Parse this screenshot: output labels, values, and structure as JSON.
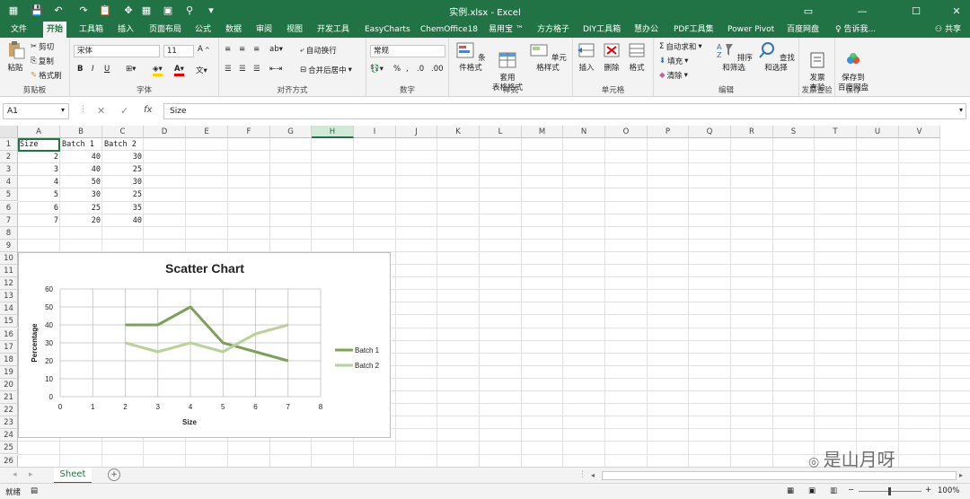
{
  "window": {
    "title": "实例.xlsx - Excel"
  },
  "menu": {
    "tabs": [
      "文件",
      "开始",
      "工具箱",
      "插入",
      "页面布局",
      "公式",
      "数据",
      "审阅",
      "视图",
      "开发工具",
      "EasyCharts",
      "ChemOffice18",
      "易用宝 ™",
      "方方格子",
      "DIY工具箱",
      "慧办公",
      "PDF工具集",
      "Power Pivot",
      "百度网盘"
    ],
    "tell_me": "告诉我...",
    "share": "共享"
  },
  "ribbon": {
    "clipboard": {
      "paste": "粘贴",
      "cut": "剪切",
      "copy": "复制",
      "format_painter": "格式刷",
      "label": "剪贴板"
    },
    "font": {
      "name": "宋体",
      "size": "11",
      "bold": "B",
      "italic": "I",
      "underline": "U",
      "label": "字体"
    },
    "alignment": {
      "wrap": "自动换行",
      "merge": "合并后居中",
      "label": "对齐方式"
    },
    "number": {
      "format": "常规",
      "percent": "%",
      "label": "数字"
    },
    "styles": {
      "conditional": "条件格式",
      "table": "套用\n表格格式",
      "cell_styles": "单元格样式",
      "label": "样式"
    },
    "cells": {
      "insert": "插入",
      "delete": "删除",
      "format": "格式",
      "label": "单元格"
    },
    "editing": {
      "autosum": "自动求和",
      "fill": "填充",
      "clear": "清除",
      "sort": "排序和筛选",
      "find": "查找和选择",
      "label": "编辑"
    },
    "invoice": {
      "check": "发票\n查验",
      "label": "发票查验"
    },
    "save": {
      "baidu": "保存到\n百度网盘",
      "label": "保存"
    }
  },
  "formula_bar": {
    "name_box": "A1",
    "content": "Size"
  },
  "sheet": {
    "columns": [
      "A",
      "B",
      "C",
      "D",
      "E",
      "F",
      "G",
      "H",
      "I",
      "J",
      "K",
      "L",
      "M",
      "N",
      "O",
      "P",
      "Q",
      "R",
      "S",
      "T",
      "U",
      "V"
    ],
    "selected_column": "H",
    "rows": [
      "1",
      "2",
      "3",
      "4",
      "5",
      "6",
      "7",
      "8",
      "9",
      "10",
      "11",
      "12",
      "13",
      "14",
      "15",
      "16",
      "17",
      "18",
      "19",
      "20",
      "21",
      "22",
      "23",
      "24",
      "25",
      "26"
    ],
    "headers": [
      "Size",
      "Batch 1",
      "Batch 2"
    ],
    "data": [
      [
        "2",
        "40",
        "30"
      ],
      [
        "3",
        "40",
        "25"
      ],
      [
        "4",
        "50",
        "30"
      ],
      [
        "5",
        "30",
        "25"
      ],
      [
        "6",
        "25",
        "35"
      ],
      [
        "7",
        "20",
        "40"
      ]
    ]
  },
  "chart_data": {
    "type": "scatter",
    "title": "Scatter Chart",
    "xlabel": "Size",
    "ylabel": "Percentage",
    "xlim": [
      0,
      8
    ],
    "ylim": [
      0,
      60
    ],
    "xticks": [
      "0",
      "1",
      "2",
      "3",
      "4",
      "5",
      "6",
      "7",
      "8"
    ],
    "yticks": [
      "0",
      "10",
      "20",
      "30",
      "40",
      "50",
      "60"
    ],
    "grid": true,
    "legend": "right",
    "x": [
      2,
      3,
      4,
      5,
      6,
      7
    ],
    "series": [
      {
        "name": "Batch 1",
        "values": [
          40,
          40,
          50,
          30,
          25,
          20
        ],
        "color": "#7da05a"
      },
      {
        "name": "Batch 2",
        "values": [
          30,
          25,
          30,
          25,
          35,
          40
        ],
        "color": "#b9d19a"
      }
    ]
  },
  "tabs": {
    "sheet": "Sheet"
  },
  "status": {
    "ready": "就绪",
    "zoom": "100%"
  },
  "watermark": "是山月呀"
}
